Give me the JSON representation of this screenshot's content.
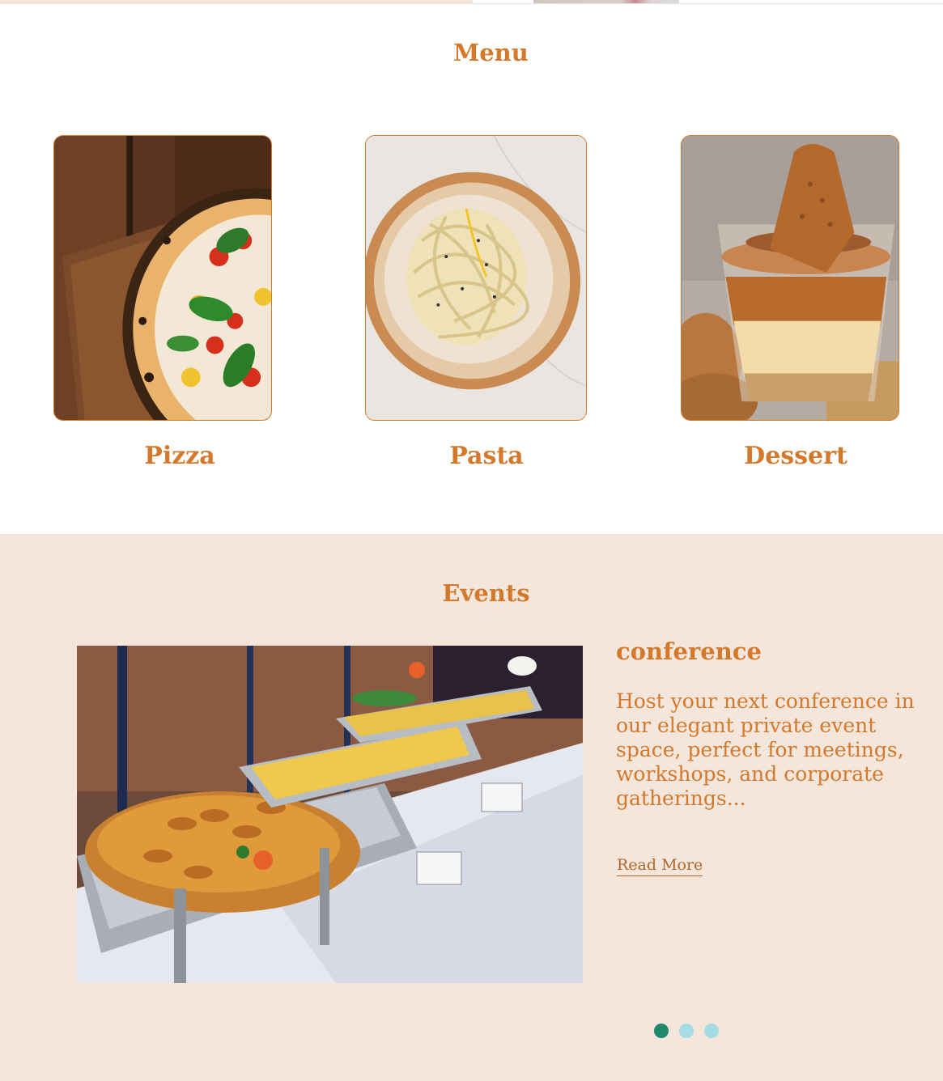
{
  "menu": {
    "title": "Menu",
    "items": [
      {
        "label": "Pizza",
        "image": "pizza-photo"
      },
      {
        "label": "Pasta",
        "image": "pasta-photo"
      },
      {
        "label": "Dessert",
        "image": "dessert-photo"
      }
    ]
  },
  "events": {
    "title": "Events",
    "slide": {
      "name": "conference",
      "description": "Host your next conference in our elegant private event space, perfect for meetings, workshops, and corporate gatherings...",
      "read_more": "Read More",
      "image": "buffet-photo"
    },
    "carousel": {
      "count": 3,
      "active_index": 0
    }
  },
  "colors": {
    "accent": "#d4782b",
    "section_bg": "#f5e6dc",
    "dot_active": "#1e8a6b",
    "dot_inactive": "#a5dce4"
  }
}
